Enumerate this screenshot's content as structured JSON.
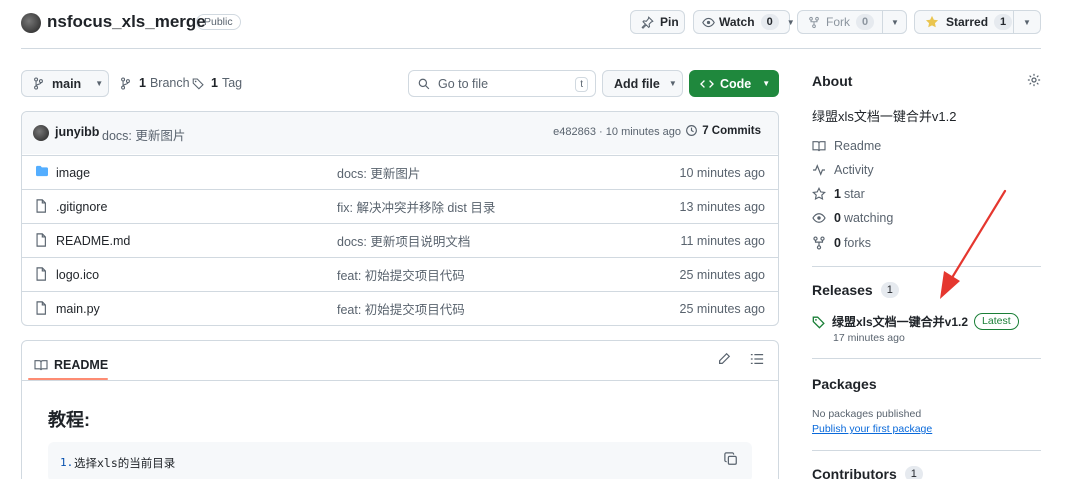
{
  "repo": {
    "name": "nsfocus_xls_merge",
    "visibility": "Public"
  },
  "actions": {
    "pin": "Pin",
    "watch": "Watch",
    "watch_count": "0",
    "fork": "Fork",
    "fork_count": "0",
    "starred": "Starred",
    "star_count": "1"
  },
  "toolbar": {
    "branch": "main",
    "branch_count": "1",
    "branch_label": "Branch",
    "tag_count": "1",
    "tag_label": "Tag",
    "goto_placeholder": "Go to file",
    "goto_key": "t",
    "add_file": "Add file",
    "code": "Code"
  },
  "commit": {
    "author": "junyibb",
    "message": "docs: 更新图片",
    "hash_time": "e482863 · 10 minutes ago",
    "commits": "7 Commits"
  },
  "files": [
    {
      "name": "image",
      "type": "folder",
      "message": "docs: 更新图片",
      "age": "10 minutes ago"
    },
    {
      "name": ".gitignore",
      "type": "file",
      "message": "fix: 解决冲突并移除 dist 目录",
      "age": "13 minutes ago"
    },
    {
      "name": "README.md",
      "type": "file",
      "message": "docs: 更新项目说明文档",
      "age": "11 minutes ago"
    },
    {
      "name": "logo.ico",
      "type": "file",
      "message": "feat: 初始提交项目代码",
      "age": "25 minutes ago"
    },
    {
      "name": "main.py",
      "type": "file",
      "message": "feat: 初始提交项目代码",
      "age": "25 minutes ago"
    }
  ],
  "readme": {
    "tab": "README",
    "heading": "教程:",
    "code_line_no": "1.",
    "code_text": "选择xls的当前目录"
  },
  "about": {
    "title": "About",
    "description": "绿盟xls文档一键合并v1.2",
    "readme": "Readme",
    "activity": "Activity",
    "stars_count": "1",
    "stars_label": "star",
    "watching_count": "0",
    "watching_label": "watching",
    "forks_count": "0",
    "forks_label": "forks"
  },
  "releases": {
    "title": "Releases",
    "count": "1",
    "name": "绿盟xls文档一键合并v1.2",
    "badge": "Latest",
    "time": "17 minutes ago"
  },
  "packages": {
    "title": "Packages",
    "none": "No packages published",
    "link": "Publish your first package"
  },
  "contributors": {
    "title": "Contributors",
    "count": "1"
  },
  "colors": {
    "accent_green": "#1f883d",
    "link_blue": "#0969da",
    "annotation_red": "#e5372f",
    "folder_blue": "#54aeff"
  }
}
